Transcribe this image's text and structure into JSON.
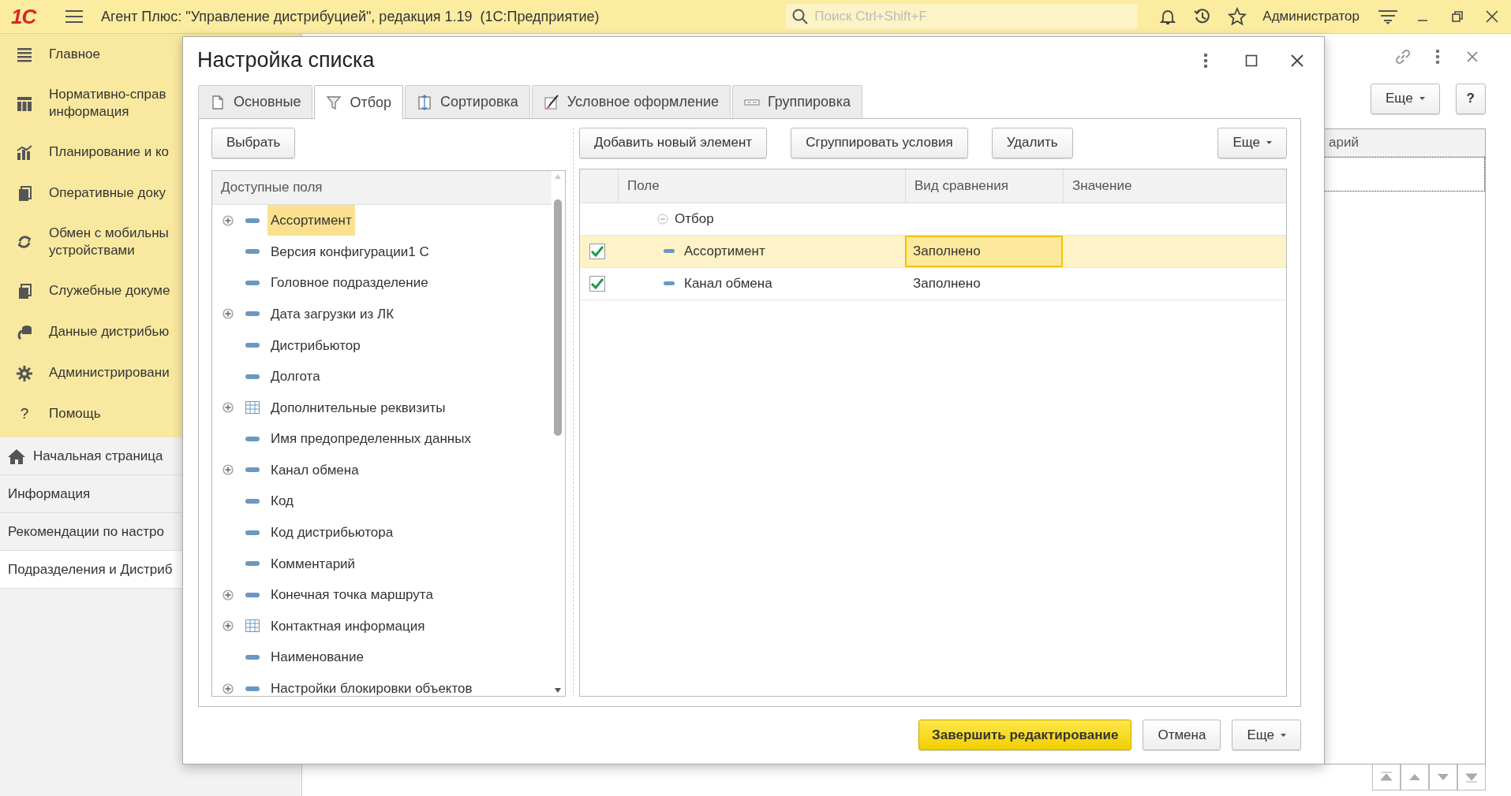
{
  "app_bar": {
    "logo": "1С",
    "title": "Агент Плюс: \"Управление дистрибуцией\", редакция 1.19  (1С:Предприятие)",
    "search": {
      "placeholder": "Поиск Ctrl+Shift+F"
    },
    "user": "Администратор"
  },
  "sidebar": {
    "sections": [
      {
        "label": "Главное"
      },
      {
        "label": "Нормативно-справ\nинформация"
      },
      {
        "label": "Планирование и ко"
      },
      {
        "label": "Оперативные доку"
      },
      {
        "label": "Обмен с мобильны\nустройствами"
      },
      {
        "label": "Служебные докуме"
      },
      {
        "label": "Данные дистрибью"
      },
      {
        "label": "Администрировани"
      },
      {
        "label": "Помощь",
        "glyph": "?"
      }
    ],
    "open_forms": [
      {
        "label": "Начальная страница",
        "kind": "home",
        "selected": false
      },
      {
        "label": "Информация",
        "kind": "page",
        "selected": false
      },
      {
        "label": "Рекомендации по настро",
        "kind": "page",
        "selected": false
      },
      {
        "label": "Подразделения и Дистриб",
        "kind": "page",
        "selected": true
      }
    ]
  },
  "background_form": {
    "more_button": "Еще",
    "help_button": "?",
    "table": {
      "columns": [
        "арий"
      ]
    }
  },
  "dialog": {
    "title": "Настройка списка",
    "tabs": [
      {
        "label": "Основные",
        "selected": false
      },
      {
        "label": "Отбор",
        "selected": true
      },
      {
        "label": "Сортировка",
        "selected": false
      },
      {
        "label": "Условное оформление",
        "selected": false
      },
      {
        "label": "Группировка",
        "selected": false
      }
    ],
    "choose_button": "Выбрать",
    "available_fields": {
      "header": "Доступные поля",
      "items": [
        {
          "label": "Ассортимент",
          "kind": "field",
          "expandable": true,
          "selected": true
        },
        {
          "label": "Версия конфигурации1 С",
          "kind": "field",
          "expandable": false,
          "selected": false
        },
        {
          "label": "Головное подразделение",
          "kind": "field",
          "expandable": false,
          "selected": false
        },
        {
          "label": "Дата загрузки из ЛК",
          "kind": "field",
          "expandable": true,
          "selected": false
        },
        {
          "label": "Дистрибьютор",
          "kind": "field",
          "expandable": false,
          "selected": false
        },
        {
          "label": "Долгота",
          "kind": "field",
          "expandable": false,
          "selected": false
        },
        {
          "label": "Дополнительные реквизиты",
          "kind": "table",
          "expandable": true,
          "selected": false
        },
        {
          "label": "Имя предопределенных данных",
          "kind": "field",
          "expandable": false,
          "selected": false
        },
        {
          "label": "Канал обмена",
          "kind": "field",
          "expandable": true,
          "selected": false
        },
        {
          "label": "Код",
          "kind": "field",
          "expandable": false,
          "selected": false
        },
        {
          "label": "Код дистрибьютора",
          "kind": "field",
          "expandable": false,
          "selected": false
        },
        {
          "label": "Комментарий",
          "kind": "field",
          "expandable": false,
          "selected": false
        },
        {
          "label": "Конечная точка маршрута",
          "kind": "field",
          "expandable": true,
          "selected": false
        },
        {
          "label": "Контактная информация",
          "kind": "table",
          "expandable": true,
          "selected": false
        },
        {
          "label": "Наименование",
          "kind": "field",
          "expandable": false,
          "selected": false
        },
        {
          "label": "Настройки блокировки объектов",
          "kind": "field",
          "expandable": true,
          "selected": false
        }
      ]
    },
    "toolbar": [
      "Добавить новый элемент",
      "Сгруппировать условия",
      "Удалить"
    ],
    "more_button": "Еще",
    "filter_table": {
      "columns": [
        "Поле",
        "Вид сравнения",
        "Значение"
      ],
      "group": {
        "label": "Отбор",
        "expanded": true,
        "children": [
          {
            "field": "Ассортимент",
            "checked": true,
            "comparison": "Заполнено",
            "selected": true
          },
          {
            "field": "Канал обмена",
            "checked": true,
            "comparison": "Заполнено",
            "selected": false
          }
        ]
      }
    },
    "footer": {
      "primary": "Завершить редактирование",
      "cancel": "Отмена",
      "more": "Еще"
    }
  }
}
